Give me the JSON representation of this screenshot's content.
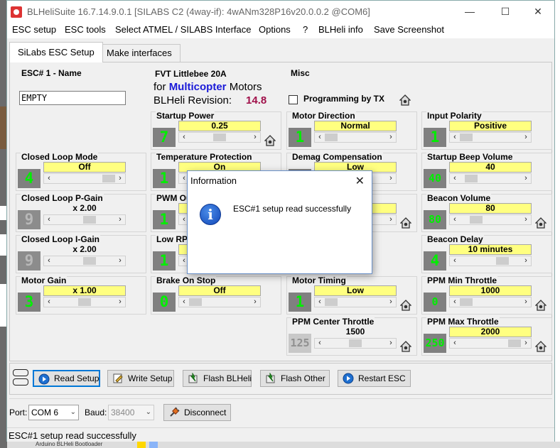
{
  "window": {
    "title": "BLHeliSuite 16.7.14.9.0.1  [SILABS C2 (4way-if): 4wANm328P16v20.0.0.2 @COM6]",
    "minimize": "—",
    "maximize": "☐",
    "close": "✕"
  },
  "menu": [
    "ESC setup",
    "ESC tools",
    "Select ATMEL / SILABS Interface",
    "Options",
    "?",
    "BLHeli info",
    "Save Screenshot"
  ],
  "tabs": [
    "SiLabs ESC Setup",
    "Make interfaces"
  ],
  "esc_name": {
    "title": "ESC# 1 - Name",
    "value": "EMPTY"
  },
  "firmware": {
    "name": "FVT Littlebee 20A",
    "for_label": "for",
    "mode": "Multicopter",
    "mode_suffix": "Motors",
    "revision_label": "BLHeli Revision:",
    "revision": "14.8"
  },
  "misc": {
    "title": "Misc",
    "programming_by_tx": "Programming by TX"
  },
  "params": {
    "startup_power": {
      "title": "Startup Power",
      "num": "7",
      "value": "0.25",
      "thumb": 0.5
    },
    "motor_direction": {
      "title": "Motor Direction",
      "num": "1",
      "value": "Normal",
      "thumb": 0.0
    },
    "input_polarity": {
      "title": "Input Polarity",
      "num": "1",
      "value": "Positive",
      "thumb": 0.0
    },
    "closed_loop_mode": {
      "title": "Closed Loop Mode",
      "num": "4",
      "value": "Off",
      "thumb": 1.0
    },
    "temperature_protection": {
      "title": "Temperature Protection",
      "num": "1",
      "value": "On",
      "thumb": 0.0
    },
    "demag_compensation": {
      "title": "Demag Compensation",
      "num": "2",
      "value": "Low",
      "thumb": 0.0
    },
    "startup_beep_volume": {
      "title": "Startup Beep Volume",
      "num": "40",
      "value": "40",
      "thumb": 0.1
    },
    "closed_loop_p_gain": {
      "title": "Closed Loop P-Gain",
      "num": "9",
      "value": "x 2.00",
      "thumb": 0.6
    },
    "pwm_output": {
      "title": "PWM Ou",
      "num": "1",
      "value": "",
      "thumb": 0.0
    },
    "damped": {
      "title": "mped",
      "num": "",
      "value": "",
      "thumb": 0.0
    },
    "beacon_volume": {
      "title": "Beacon Volume",
      "num": "80",
      "value": "80",
      "thumb": 0.2
    },
    "closed_loop_i_gain": {
      "title": "Closed Loop I-Gain",
      "num": "9",
      "value": "x 2.00",
      "thumb": 0.6
    },
    "low_rpm": {
      "title": "Low RP",
      "num": "1",
      "value": "",
      "thumb": 0.0
    },
    "beacon_delay": {
      "title": "Beacon Delay",
      "num": "4",
      "value": "10 minutes",
      "thumb": 0.75
    },
    "motor_gain": {
      "title": "Motor Gain",
      "num": "3",
      "value": "x 1.00",
      "thumb": 0.5
    },
    "brake_on_stop": {
      "title": "Brake On Stop",
      "num": "0",
      "value": "Off",
      "thumb": 0.0
    },
    "motor_timing": {
      "title": "Motor Timing",
      "num": "1",
      "value": "Low",
      "thumb": 0.0
    },
    "ppm_min_throttle": {
      "title": "PPM Min Throttle",
      "num": "0",
      "value": "1000",
      "thumb": 0.0
    },
    "ppm_center_throttle": {
      "title": "PPM Center Throttle",
      "num": "125",
      "value": "1500",
      "thumb": 0.5
    },
    "ppm_max_throttle": {
      "title": "PPM Max Throttle",
      "num": "250",
      "value": "2000",
      "thumb": 1.0
    }
  },
  "buttons": [
    "Read Setup",
    "Write Setup",
    "Flash BLHeli",
    "Flash Other",
    "Restart ESC"
  ],
  "port": {
    "port_label": "Port:",
    "port_value": "COM 6",
    "baud_label": "Baud:",
    "baud_value": "38400",
    "disconnect": "Disconnect"
  },
  "status": "ESC#1 setup read successfully",
  "dialog": {
    "title": "Information",
    "message": "ESC#1 setup read successfully"
  },
  "background": {
    "bottom_text": "Arduino BLHeli Bootloader",
    "c_badge": "C",
    "i_badge": "I"
  },
  "colors": {
    "value_bg": "#ffff80",
    "digit": "#00ee00",
    "accent": "#0078d7",
    "multicopter": "#1a1ad8",
    "revision": "#a0104a"
  }
}
